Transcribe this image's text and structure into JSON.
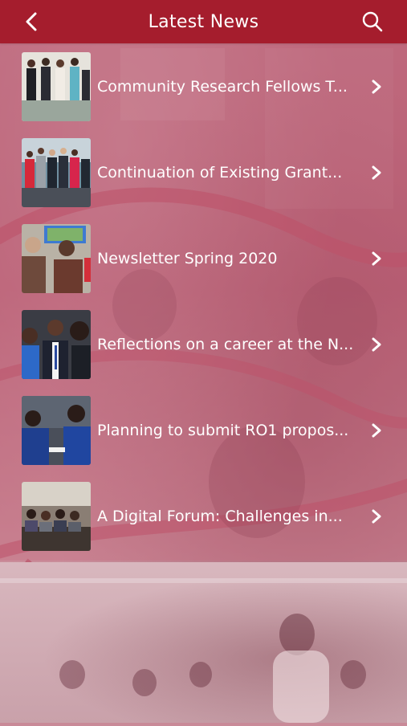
{
  "header": {
    "title": "Latest News",
    "back_icon": "chevron-left-icon",
    "search_icon": "search-icon"
  },
  "colors": {
    "header_bg": "#a51d2d",
    "text": "#ffffff",
    "list_tint": "#c86e82"
  },
  "news": [
    {
      "title": "Community Research Fellows T...",
      "thumb_icon": "group-photo"
    },
    {
      "title": "Continuation of Existing Grant...",
      "thumb_icon": "group-photo"
    },
    {
      "title": " Newsletter Spring 2020",
      "thumb_icon": "meeting-photo"
    },
    {
      "title": "Reflections on a career at the N...",
      "thumb_icon": "portrait-photo"
    },
    {
      "title": "Planning to submit RO1 propos...",
      "thumb_icon": "presentation-photo"
    },
    {
      "title": "A Digital Forum: Challenges in...",
      "thumb_icon": "forum-photo"
    }
  ]
}
